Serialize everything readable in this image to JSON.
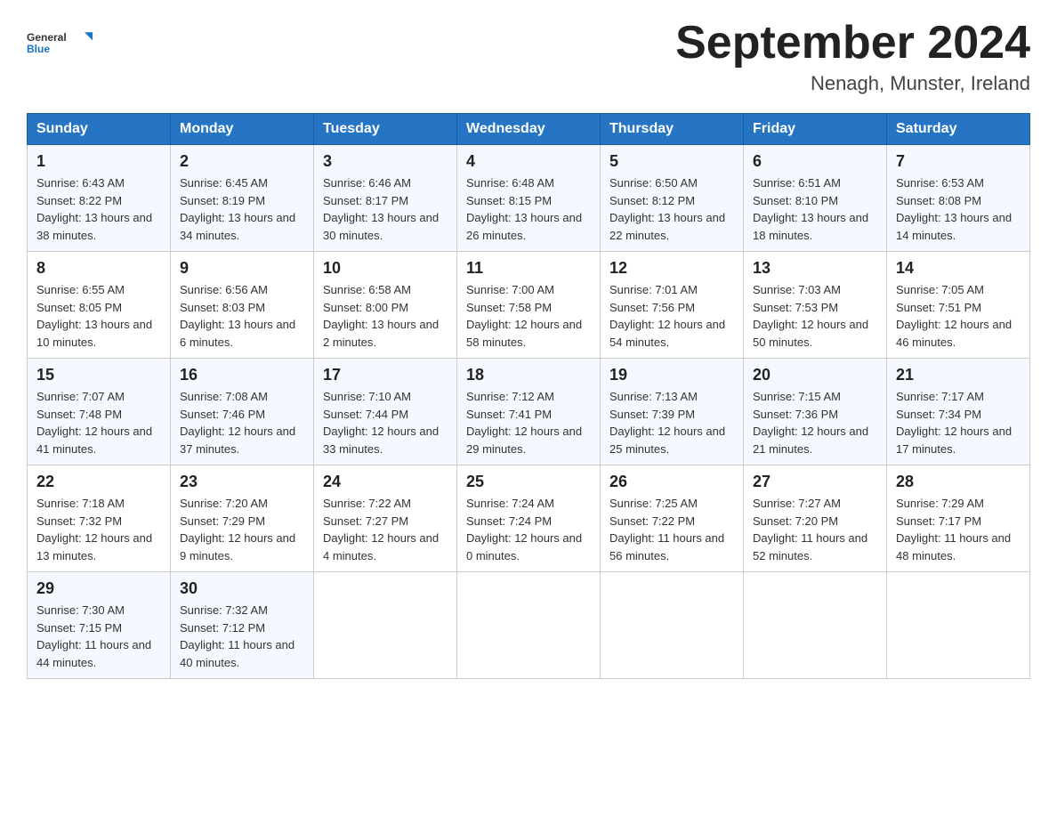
{
  "header": {
    "logo_text_general": "General",
    "logo_text_blue": "Blue",
    "month_title": "September 2024",
    "location": "Nenagh, Munster, Ireland"
  },
  "days_of_week": [
    "Sunday",
    "Monday",
    "Tuesday",
    "Wednesday",
    "Thursday",
    "Friday",
    "Saturday"
  ],
  "weeks": [
    [
      {
        "day": "1",
        "sunrise": "6:43 AM",
        "sunset": "8:22 PM",
        "daylight": "13 hours and 38 minutes."
      },
      {
        "day": "2",
        "sunrise": "6:45 AM",
        "sunset": "8:19 PM",
        "daylight": "13 hours and 34 minutes."
      },
      {
        "day": "3",
        "sunrise": "6:46 AM",
        "sunset": "8:17 PM",
        "daylight": "13 hours and 30 minutes."
      },
      {
        "day": "4",
        "sunrise": "6:48 AM",
        "sunset": "8:15 PM",
        "daylight": "13 hours and 26 minutes."
      },
      {
        "day": "5",
        "sunrise": "6:50 AM",
        "sunset": "8:12 PM",
        "daylight": "13 hours and 22 minutes."
      },
      {
        "day": "6",
        "sunrise": "6:51 AM",
        "sunset": "8:10 PM",
        "daylight": "13 hours and 18 minutes."
      },
      {
        "day": "7",
        "sunrise": "6:53 AM",
        "sunset": "8:08 PM",
        "daylight": "13 hours and 14 minutes."
      }
    ],
    [
      {
        "day": "8",
        "sunrise": "6:55 AM",
        "sunset": "8:05 PM",
        "daylight": "13 hours and 10 minutes."
      },
      {
        "day": "9",
        "sunrise": "6:56 AM",
        "sunset": "8:03 PM",
        "daylight": "13 hours and 6 minutes."
      },
      {
        "day": "10",
        "sunrise": "6:58 AM",
        "sunset": "8:00 PM",
        "daylight": "13 hours and 2 minutes."
      },
      {
        "day": "11",
        "sunrise": "7:00 AM",
        "sunset": "7:58 PM",
        "daylight": "12 hours and 58 minutes."
      },
      {
        "day": "12",
        "sunrise": "7:01 AM",
        "sunset": "7:56 PM",
        "daylight": "12 hours and 54 minutes."
      },
      {
        "day": "13",
        "sunrise": "7:03 AM",
        "sunset": "7:53 PM",
        "daylight": "12 hours and 50 minutes."
      },
      {
        "day": "14",
        "sunrise": "7:05 AM",
        "sunset": "7:51 PM",
        "daylight": "12 hours and 46 minutes."
      }
    ],
    [
      {
        "day": "15",
        "sunrise": "7:07 AM",
        "sunset": "7:48 PM",
        "daylight": "12 hours and 41 minutes."
      },
      {
        "day": "16",
        "sunrise": "7:08 AM",
        "sunset": "7:46 PM",
        "daylight": "12 hours and 37 minutes."
      },
      {
        "day": "17",
        "sunrise": "7:10 AM",
        "sunset": "7:44 PM",
        "daylight": "12 hours and 33 minutes."
      },
      {
        "day": "18",
        "sunrise": "7:12 AM",
        "sunset": "7:41 PM",
        "daylight": "12 hours and 29 minutes."
      },
      {
        "day": "19",
        "sunrise": "7:13 AM",
        "sunset": "7:39 PM",
        "daylight": "12 hours and 25 minutes."
      },
      {
        "day": "20",
        "sunrise": "7:15 AM",
        "sunset": "7:36 PM",
        "daylight": "12 hours and 21 minutes."
      },
      {
        "day": "21",
        "sunrise": "7:17 AM",
        "sunset": "7:34 PM",
        "daylight": "12 hours and 17 minutes."
      }
    ],
    [
      {
        "day": "22",
        "sunrise": "7:18 AM",
        "sunset": "7:32 PM",
        "daylight": "12 hours and 13 minutes."
      },
      {
        "day": "23",
        "sunrise": "7:20 AM",
        "sunset": "7:29 PM",
        "daylight": "12 hours and 9 minutes."
      },
      {
        "day": "24",
        "sunrise": "7:22 AM",
        "sunset": "7:27 PM",
        "daylight": "12 hours and 4 minutes."
      },
      {
        "day": "25",
        "sunrise": "7:24 AM",
        "sunset": "7:24 PM",
        "daylight": "12 hours and 0 minutes."
      },
      {
        "day": "26",
        "sunrise": "7:25 AM",
        "sunset": "7:22 PM",
        "daylight": "11 hours and 56 minutes."
      },
      {
        "day": "27",
        "sunrise": "7:27 AM",
        "sunset": "7:20 PM",
        "daylight": "11 hours and 52 minutes."
      },
      {
        "day": "28",
        "sunrise": "7:29 AM",
        "sunset": "7:17 PM",
        "daylight": "11 hours and 48 minutes."
      }
    ],
    [
      {
        "day": "29",
        "sunrise": "7:30 AM",
        "sunset": "7:15 PM",
        "daylight": "11 hours and 44 minutes."
      },
      {
        "day": "30",
        "sunrise": "7:32 AM",
        "sunset": "7:12 PM",
        "daylight": "11 hours and 40 minutes."
      },
      null,
      null,
      null,
      null,
      null
    ]
  ],
  "labels": {
    "sunrise": "Sunrise:",
    "sunset": "Sunset:",
    "daylight": "Daylight:"
  }
}
